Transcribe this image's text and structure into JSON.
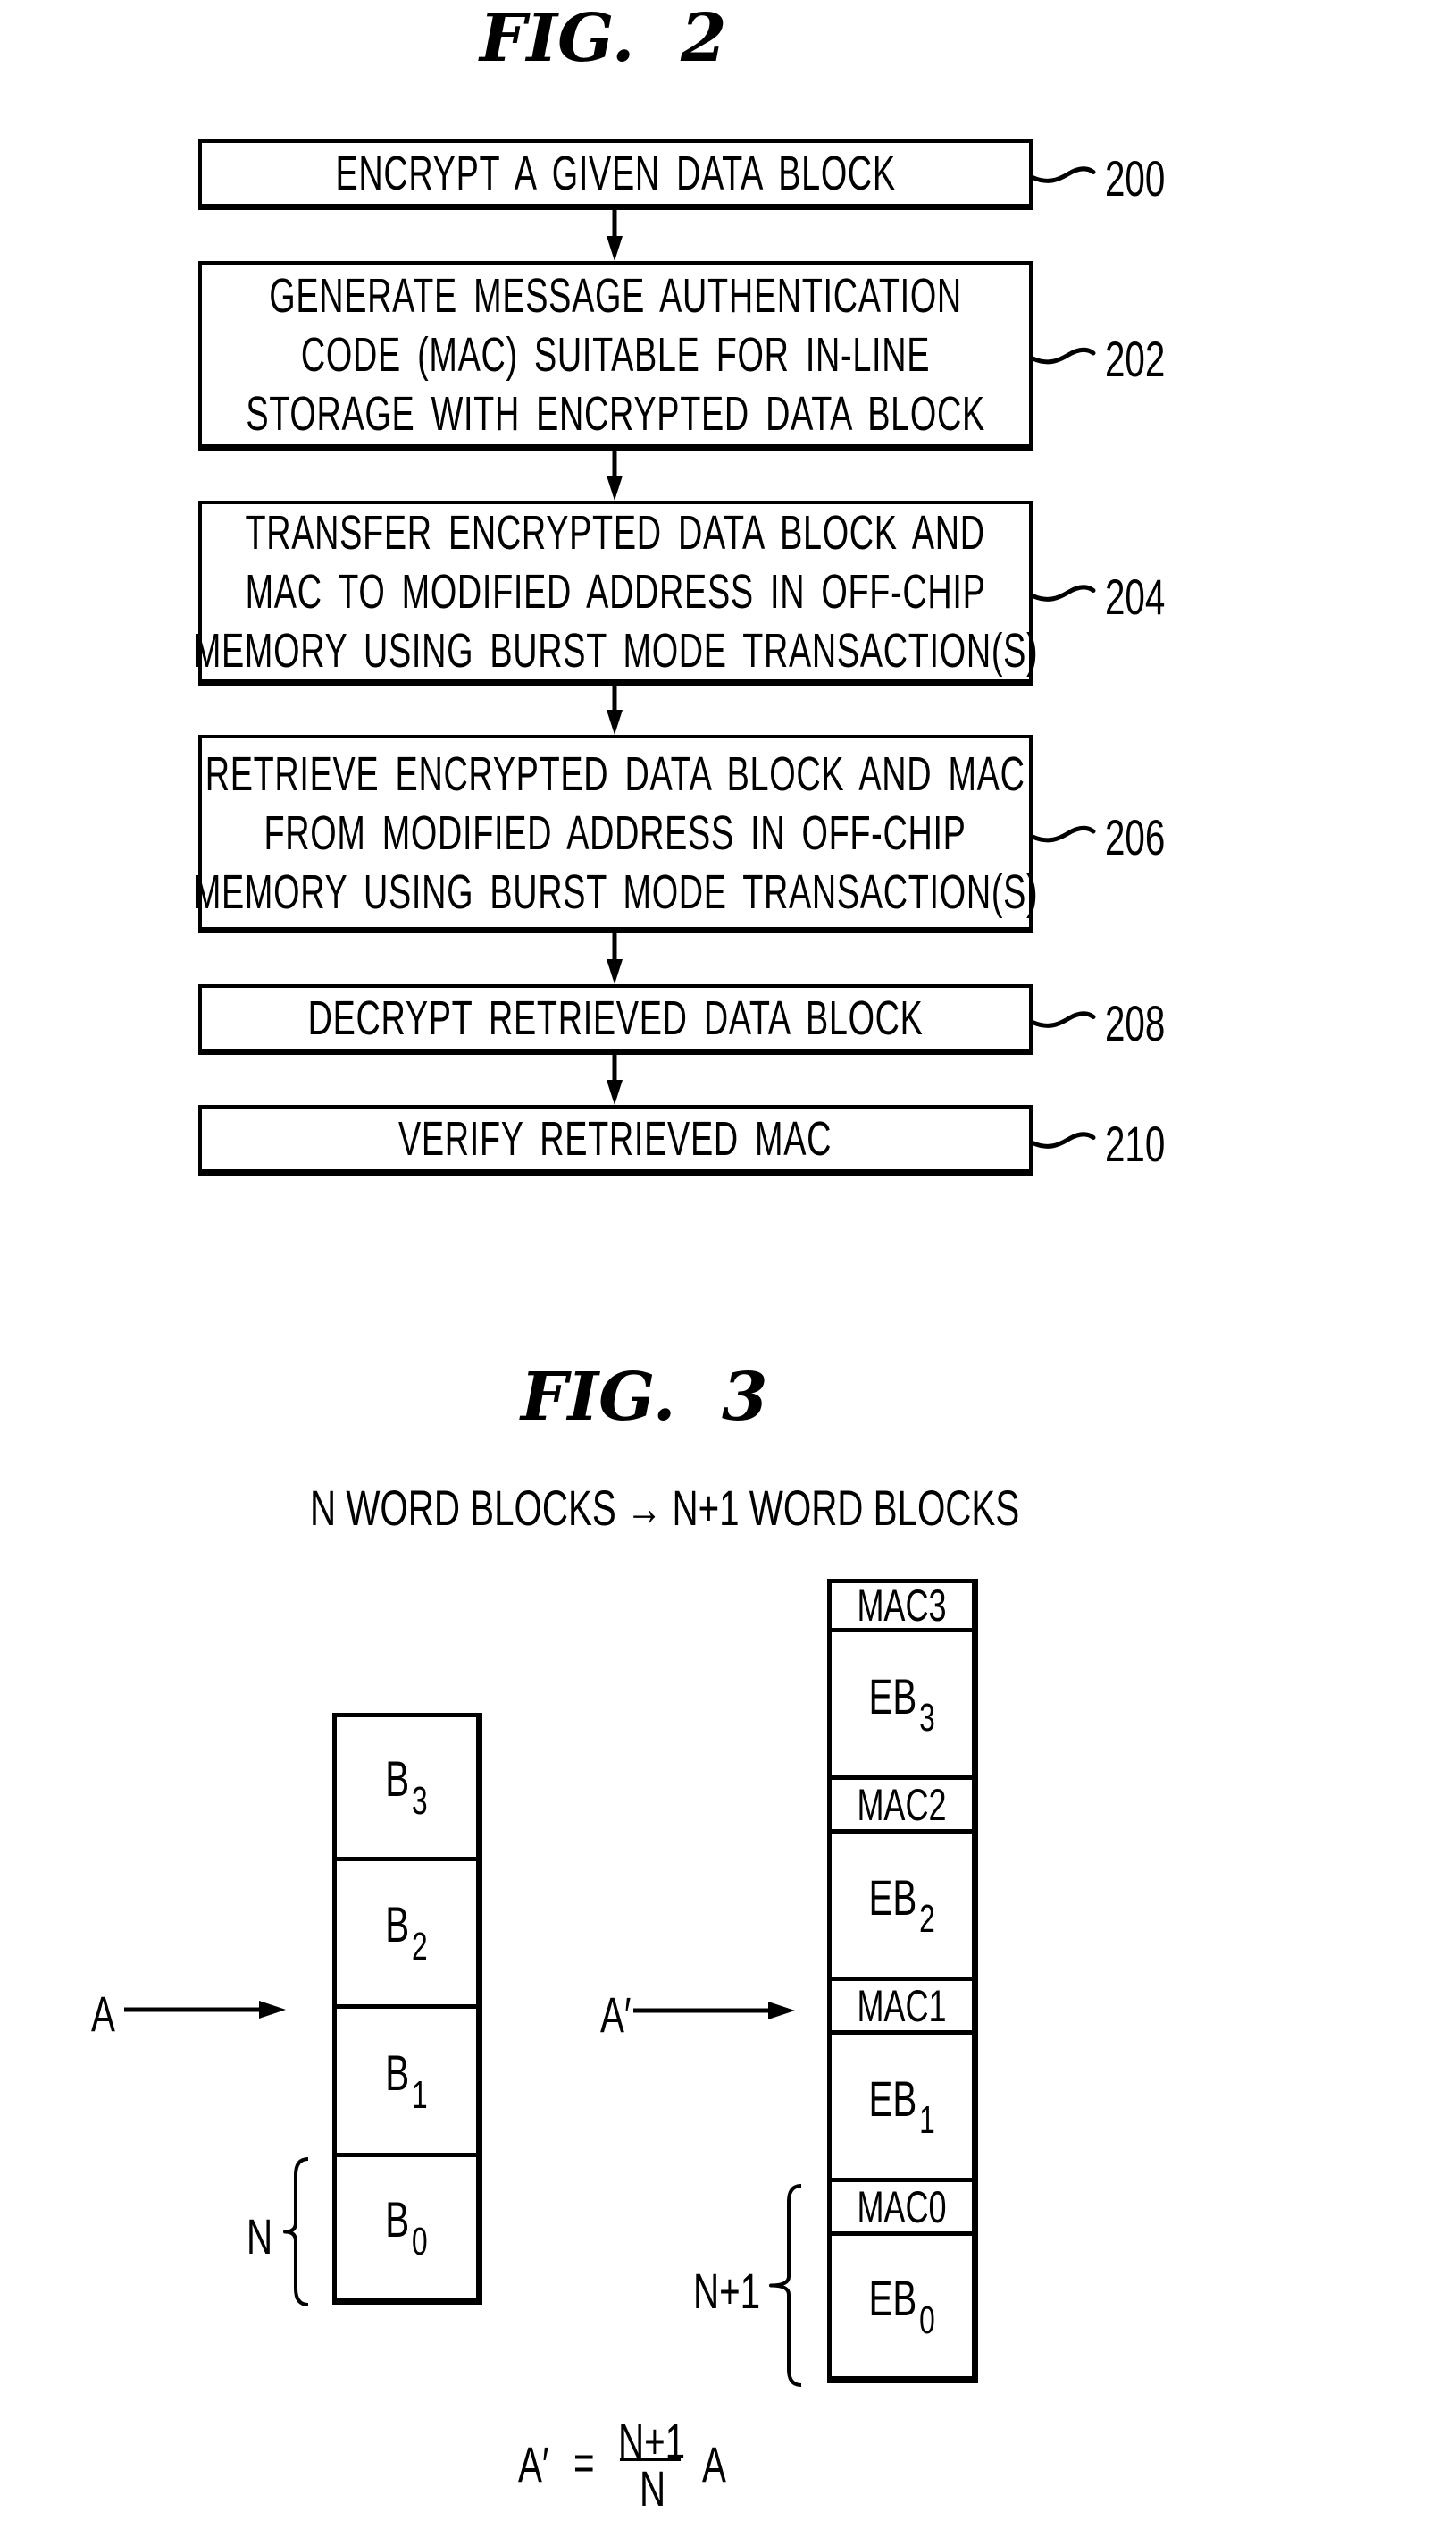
{
  "fig2": {
    "title": "FIG.  2",
    "steps": [
      {
        "ref": "200",
        "lines": [
          "ENCRYPT A GIVEN DATA BLOCK"
        ]
      },
      {
        "ref": "202",
        "lines": [
          "GENERATE MESSAGE AUTHENTICATION",
          "CODE (MAC) SUITABLE FOR IN-LINE",
          "STORAGE WITH ENCRYPTED DATA BLOCK"
        ]
      },
      {
        "ref": "204",
        "lines": [
          "TRANSFER ENCRYPTED DATA BLOCK AND",
          "MAC TO MODIFIED ADDRESS IN OFF-CHIP",
          "MEMORY USING BURST MODE TRANSACTION(S)"
        ]
      },
      {
        "ref": "206",
        "lines": [
          "RETRIEVE ENCRYPTED DATA BLOCK AND MAC",
          "FROM MODIFIED ADDRESS IN OFF-CHIP",
          "MEMORY USING BURST MODE TRANSACTION(S)"
        ]
      },
      {
        "ref": "208",
        "lines": [
          "DECRYPT RETRIEVED DATA BLOCK"
        ]
      },
      {
        "ref": "210",
        "lines": [
          "VERIFY RETRIEVED MAC"
        ]
      }
    ]
  },
  "fig3": {
    "title": "FIG.  3",
    "subtitle": "N WORD BLOCKS → N+1 WORD BLOCKS",
    "left_column": {
      "pointer_label": "A",
      "brace_label": "N",
      "cells": [
        {
          "base": "B",
          "sub": "3"
        },
        {
          "base": "B",
          "sub": "2"
        },
        {
          "base": "B",
          "sub": "1"
        },
        {
          "base": "B",
          "sub": "0"
        }
      ]
    },
    "right_column": {
      "pointer_label": "A′",
      "brace_label": "N+1",
      "cells": [
        {
          "kind": "mac",
          "base": "MAC3",
          "sub": ""
        },
        {
          "kind": "data",
          "base": "EB",
          "sub": "3"
        },
        {
          "kind": "mac",
          "base": "MAC2",
          "sub": ""
        },
        {
          "kind": "data",
          "base": "EB",
          "sub": "2"
        },
        {
          "kind": "mac",
          "base": "MAC1",
          "sub": ""
        },
        {
          "kind": "data",
          "base": "EB",
          "sub": "1"
        },
        {
          "kind": "mac",
          "base": "MAC0",
          "sub": ""
        },
        {
          "kind": "data",
          "base": "EB",
          "sub": "0"
        }
      ]
    },
    "formula": {
      "lhs": "A′",
      "equals": "=",
      "numerator": "N+1",
      "denominator": "N",
      "rhs": "A"
    }
  }
}
